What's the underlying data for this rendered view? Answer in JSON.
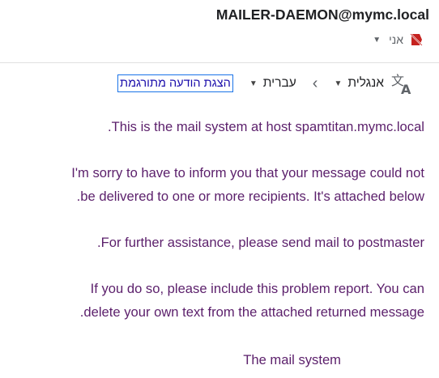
{
  "header": {
    "sender": "MAILER-DAEMON@mymc.local",
    "recipient": "אני",
    "label_icon": "important-label-icon"
  },
  "translate_bar": {
    "icon": "translate-icon",
    "from_language": "אנגלית",
    "to_language": "עברית",
    "show_translated": "הצגת הודעה מתורגמת"
  },
  "message": {
    "line1": ".This is the mail system at host spamtitan.mymc.local",
    "line2": "I'm sorry to have to inform you that your message could not",
    "line3": ".be delivered to one or more recipients. It's attached below",
    "line4": ".For further assistance, please send mail to postmaster",
    "line5": "If you do so, please include this problem report. You can",
    "line6": ".delete your own text from the attached returned message",
    "signature": "The mail system"
  },
  "colors": {
    "body_text": "#5b1f6b",
    "link": "#1a0dab",
    "label_icon": "#c5221f"
  }
}
